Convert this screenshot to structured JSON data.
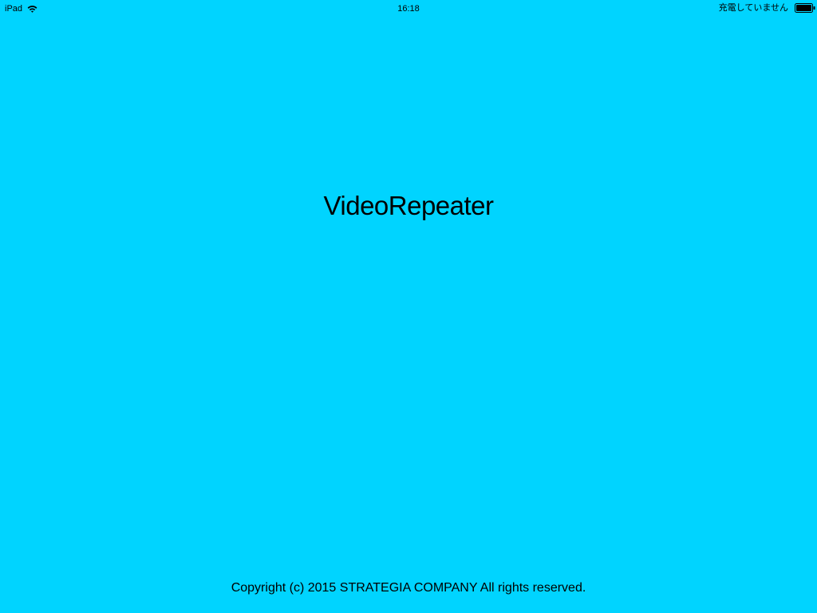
{
  "colors": {
    "background": "#00d4ff",
    "text": "#000000"
  },
  "status_bar": {
    "device": "iPad",
    "wifi_icon": "wifi-icon",
    "time": "16:18",
    "charge_status": "充電していません",
    "battery_icon": "battery-icon"
  },
  "main": {
    "title": "VideoRepeater",
    "copyright": "Copyright (c) 2015 STRATEGIA COMPANY All rights reserved."
  }
}
